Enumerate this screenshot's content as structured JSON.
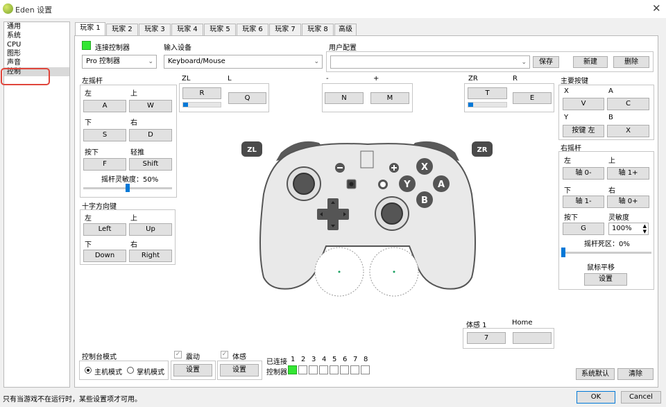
{
  "window": {
    "title": "Eden 设置",
    "close": "✕"
  },
  "sidebar": {
    "items": [
      "通用",
      "系统",
      "CPU",
      "图形",
      "声音",
      "控制"
    ],
    "selected": "控制"
  },
  "tabs": [
    "玩家 1",
    "玩家 2",
    "玩家 3",
    "玩家 4",
    "玩家 5",
    "玩家 6",
    "玩家 7",
    "玩家 8",
    "高级"
  ],
  "header": {
    "connect_label": "连接控制器",
    "controller_type": "Pro 控制器",
    "input_device_label": "输入设备",
    "input_device": "Keyboard/Mouse",
    "user_config_label": "用户配置",
    "user_config": "",
    "save": "保存",
    "new": "新建",
    "delete": "删除"
  },
  "left_stick": {
    "title": "左摇杆",
    "left": "左",
    "left_key": "A",
    "up": "上",
    "up_key": "W",
    "down": "下",
    "down_key": "S",
    "right": "右",
    "right_key": "D",
    "press": "按下",
    "press_key": "F",
    "modifier": "轻推",
    "modifier_key": "Shift",
    "sensitivity": "摇杆灵敏度：50%",
    "sensitivity_value": 0.5
  },
  "dpad": {
    "title": "十字方向键",
    "left": "左",
    "left_key": "Left",
    "up": "上",
    "up_key": "Up",
    "down": "下",
    "down_key": "Down",
    "right": "右",
    "right_key": "Right"
  },
  "zl": {
    "label": "ZL",
    "key": "R",
    "level": 0.05
  },
  "l": {
    "label": "L",
    "key": "Q"
  },
  "minus": {
    "label": "-",
    "key": "N"
  },
  "plus": {
    "label": "+",
    "key": "M"
  },
  "zr": {
    "label": "ZR",
    "key": "T",
    "level": 0.05
  },
  "r": {
    "label": "R",
    "key": "E"
  },
  "face": {
    "title": "主要按键",
    "x": "X",
    "x_key": "V",
    "a": "A",
    "a_key": "C",
    "y": "Y",
    "y_key": "按键 左",
    "b": "B",
    "b_key": "X"
  },
  "right_stick": {
    "title": "右摇杆",
    "left": "左",
    "left_key": "轴 0-",
    "up": "上",
    "up_key": "轴 1+",
    "down": "下",
    "down_key": "轴 1-",
    "right": "右",
    "right_key": "轴 0+",
    "press": "按下",
    "press_key": "G",
    "sens_label": "灵敏度",
    "sens": "100%",
    "deadzone": "摇杆死区：0%",
    "deadzone_value": 0,
    "mouse_pan": "鼠标平移",
    "mouse_pan_btn": "设置"
  },
  "controller_art": {
    "zl": "ZL",
    "zr": "ZR",
    "x": "X",
    "y": "Y",
    "a": "A",
    "b": "B"
  },
  "motion": {
    "label": "体感 1",
    "key": "7"
  },
  "home": {
    "label": "Home",
    "key": ""
  },
  "console_mode": {
    "title": "控制台模式",
    "docked": "主机模式",
    "handheld": "掌机模式",
    "selected": "主机模式"
  },
  "vibration": {
    "label": "震动",
    "btn": "设置"
  },
  "motion_cfg": {
    "label": "体感",
    "btn": "设置"
  },
  "connected": {
    "label": "已连接",
    "controllers_label": "控制器",
    "numbers": [
      "1",
      "2",
      "3",
      "4",
      "5",
      "6",
      "7",
      "8"
    ],
    "states": [
      true,
      false,
      false,
      false,
      false,
      false,
      false,
      false
    ]
  },
  "bottom": {
    "defaults": "系统默认",
    "clear": "清除",
    "ok": "OK",
    "cancel": "Cancel",
    "status": "只有当游戏不在运行时，某些设置项才可用。"
  },
  "colors": {
    "accent": "#0078d7",
    "connected": "#33e633",
    "highlight": "#e0453b"
  }
}
